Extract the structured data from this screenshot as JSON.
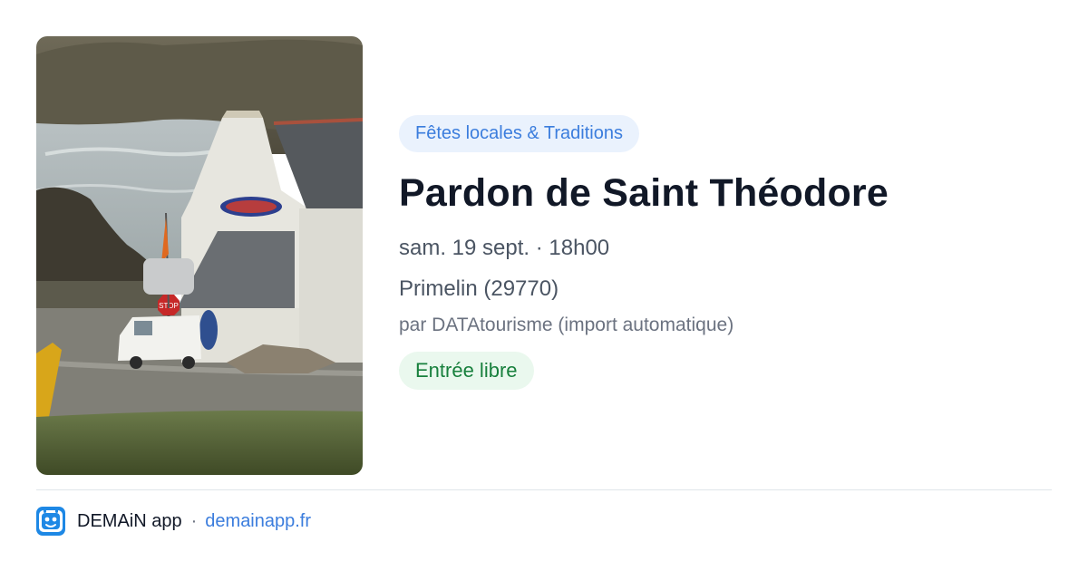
{
  "event": {
    "category": "Fêtes locales & Traditions",
    "title": "Pardon de Saint Théodore",
    "datetime": "sam. 19 sept. · 18h00",
    "location": "Primelin (29770)",
    "source": "par DATAtourisme (import automatique)",
    "price": "Entrée libre"
  },
  "photo": {
    "icon": "photo-coastal-chapel",
    "sign_text": "STOP"
  },
  "footer": {
    "app_name": "DEMAiN app",
    "separator": "·",
    "domain": "demainapp.fr",
    "logo_icon": "demain-logo-icon"
  },
  "colors": {
    "accent": "#3b7ddd",
    "category_bg": "#eaf2fd",
    "price_text": "#18803d",
    "price_bg": "#eaf8ee"
  }
}
